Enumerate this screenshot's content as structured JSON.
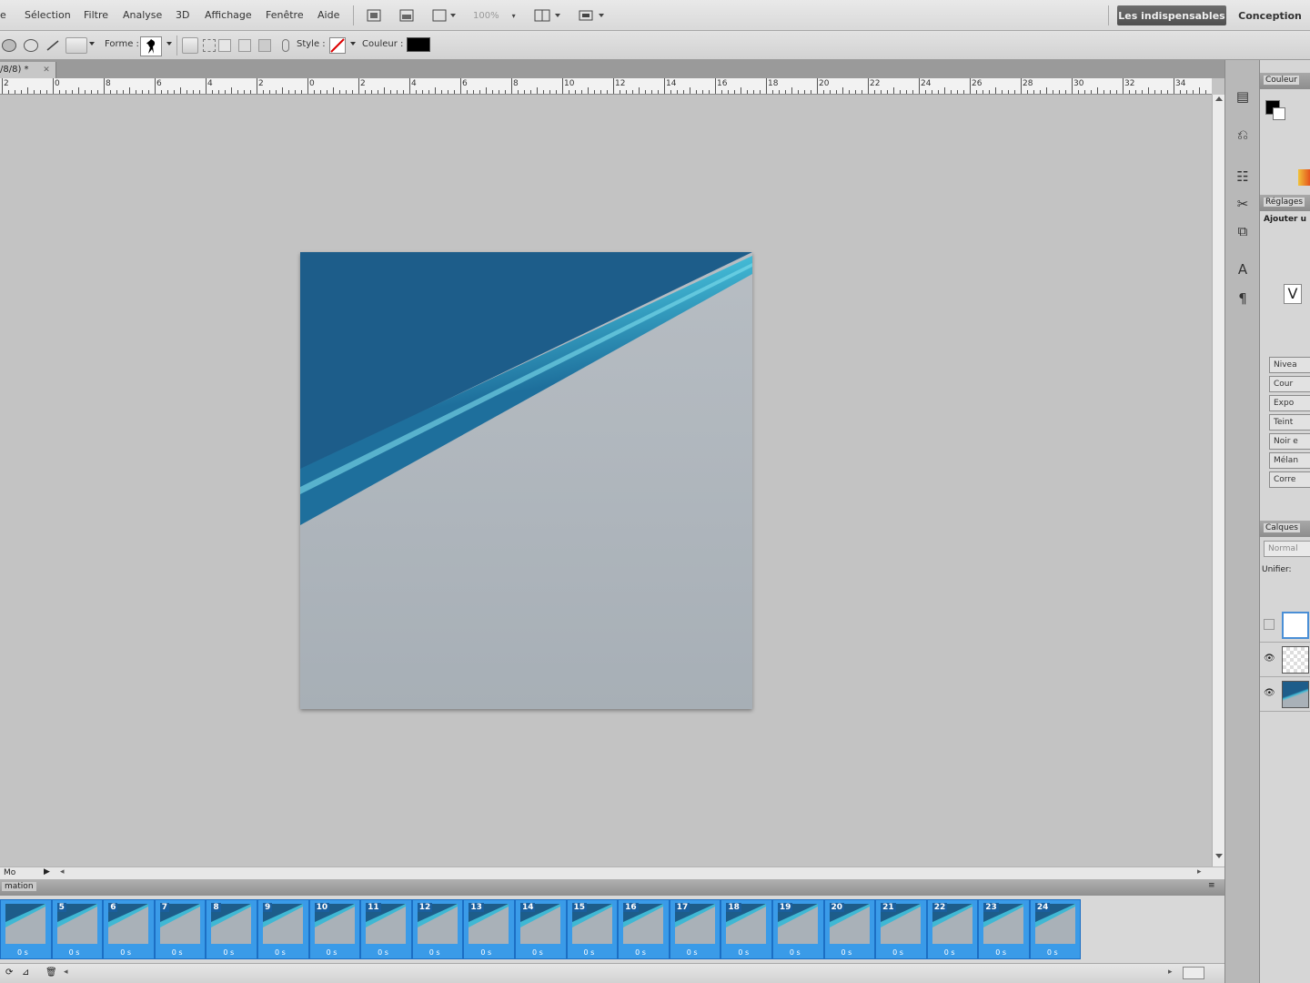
{
  "menubar": {
    "items": [
      "e",
      "Sélection",
      "Filtre",
      "Analyse",
      "3D",
      "Affichage",
      "Fenêtre",
      "Aide"
    ],
    "zoom": "100%",
    "workspace_essentials": "Les indispensables",
    "workspace_design": "Conception"
  },
  "options": {
    "shape_label": "Forme :",
    "style_label": "Style :",
    "color_label": "Couleur :",
    "color_value": "#000000"
  },
  "document": {
    "tab_title": "/8/8) *"
  },
  "ruler": {
    "labels": [
      "2",
      "0",
      "8",
      "6",
      "4",
      "2",
      "0",
      "2",
      "4",
      "6",
      "8",
      "10",
      "12",
      "14",
      "16",
      "18",
      "20",
      "22",
      "24",
      "26",
      "28",
      "30",
      "32",
      "34"
    ]
  },
  "status": {
    "text": "Mo"
  },
  "animation": {
    "panel_title": "mation",
    "frames": [
      {
        "number": "",
        "delay": "0 s"
      },
      {
        "number": "5",
        "delay": "0 s"
      },
      {
        "number": "6",
        "delay": "0 s"
      },
      {
        "number": "7",
        "delay": "0 s"
      },
      {
        "number": "8",
        "delay": "0 s"
      },
      {
        "number": "9",
        "delay": "0 s"
      },
      {
        "number": "10",
        "delay": "0 s"
      },
      {
        "number": "11",
        "delay": "0 s"
      },
      {
        "number": "12",
        "delay": "0 s"
      },
      {
        "number": "13",
        "delay": "0 s"
      },
      {
        "number": "14",
        "delay": "0 s"
      },
      {
        "number": "15",
        "delay": "0 s"
      },
      {
        "number": "16",
        "delay": "0 s"
      },
      {
        "number": "17",
        "delay": "0 s"
      },
      {
        "number": "18",
        "delay": "0 s"
      },
      {
        "number": "19",
        "delay": "0 s"
      },
      {
        "number": "20",
        "delay": "0 s"
      },
      {
        "number": "21",
        "delay": "0 s"
      },
      {
        "number": "22",
        "delay": "0 s"
      },
      {
        "number": "23",
        "delay": "0 s"
      },
      {
        "number": "24",
        "delay": "0 s"
      }
    ]
  },
  "panels": {
    "color_tab": "Couleur",
    "adjust_tab": "Réglages",
    "adjust_add": "Ajouter u",
    "adjust_items": [
      "Nivea",
      "Cour",
      "Expo",
      "Teint",
      "Noir e",
      "Mélan",
      "Corre"
    ],
    "layers_tab": "Calques",
    "blend_mode": "Normal",
    "unify_label": "Unifier:"
  },
  "colors": {
    "accent_blue": "#3a9be8",
    "image_dark_blue": "#1d5d8a",
    "image_cyan": "#3fb8d4",
    "image_gray": "#a9b1b8"
  }
}
